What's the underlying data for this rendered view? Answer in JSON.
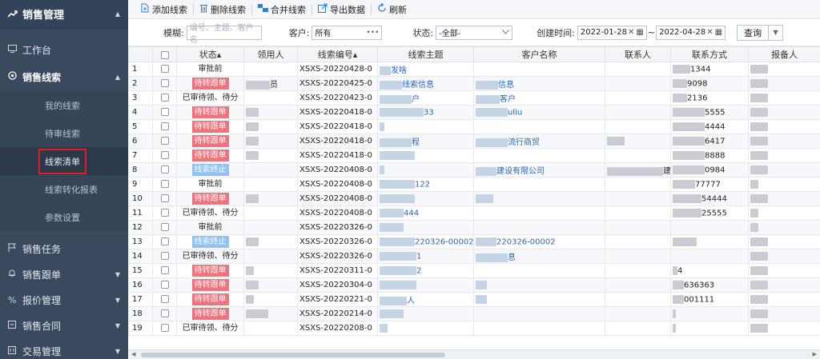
{
  "sidebar": {
    "header": {
      "icon": "trend-line-icon",
      "label": "销售管理"
    },
    "items": [
      {
        "icon": "monitor-icon",
        "label": "工作台"
      },
      {
        "icon": "settings-icon",
        "label": "销售线索",
        "expanded": true,
        "children": [
          {
            "label": "我的线索"
          },
          {
            "label": "待审线索"
          },
          {
            "label": "线索清单",
            "active": true
          },
          {
            "label": "线索转化报表"
          },
          {
            "label": "参数设置"
          }
        ]
      },
      {
        "icon": "flag-icon",
        "label": "销售任务"
      },
      {
        "icon": "bell-icon",
        "label": "销售跟单"
      },
      {
        "icon": "percent-icon",
        "label": "报价管理"
      },
      {
        "icon": "contract-icon",
        "label": "销售合同"
      },
      {
        "icon": "deal-icon",
        "label": "交易管理"
      }
    ]
  },
  "toolbar": {
    "add": "添加线索",
    "delete": "删除线索",
    "merge": "合并线索",
    "export": "导出数据",
    "refresh": "刷新"
  },
  "filters": {
    "fuzzy_label": "模糊:",
    "fuzzy_placeholder": "编号、主题、客户名",
    "customer_label": "客户:",
    "customer_value": "所有",
    "status_label": "状态:",
    "status_value": "-全部-",
    "created_label": "创建时间:",
    "date_from": "2022-01-28",
    "date_to": "2022-04-28",
    "range_sep": "~",
    "query_label": "查询"
  },
  "table": {
    "columns": [
      "",
      "",
      "状态",
      "领用人",
      "线索编号",
      "线索主题",
      "客户名称",
      "联系人",
      "联系方式",
      "报备人"
    ],
    "sort_marks": {
      "状态": "▴",
      "线索编号": "▴"
    },
    "rows": [
      {
        "n": "1",
        "status": "审批前",
        "status_style": "plain",
        "owner": "",
        "code": "XSXS-20220428-0",
        "topic": "发啥",
        "customer": "",
        "contact": "",
        "phone": "1344",
        "reporter": ""
      },
      {
        "n": "2",
        "status": "待转跟单",
        "status_style": "red",
        "owner": "员",
        "code": "XSXS-20220425-0",
        "topic": "线索信息",
        "customer": "信息",
        "contact": "",
        "phone": "9098",
        "reporter": ""
      },
      {
        "n": "3",
        "status": "已审待领、待分",
        "status_style": "plain",
        "owner": "",
        "code": "XSXS-20220423-0",
        "topic": "户",
        "customer": "客户",
        "contact": "",
        "phone": "2136",
        "reporter": ""
      },
      {
        "n": "4",
        "status": "待转跟单",
        "status_style": "red",
        "owner": "",
        "code": "XSXS-20220418-0",
        "topic": "33",
        "customer": "uliu",
        "contact": "",
        "phone": "5555",
        "reporter": ""
      },
      {
        "n": "5",
        "status": "待转跟单",
        "status_style": "red",
        "owner": "",
        "code": "XSXS-20220418-0",
        "topic": "",
        "customer": "",
        "contact": "",
        "phone": "4444",
        "reporter": ""
      },
      {
        "n": "6",
        "status": "待转跟单",
        "status_style": "red",
        "owner": "",
        "code": "XSXS-20220418-0",
        "topic": "程",
        "customer": "流行商贸",
        "contact": "",
        "phone": "6417",
        "reporter": ""
      },
      {
        "n": "7",
        "status": "待转跟单",
        "status_style": "red",
        "owner": "",
        "code": "XSXS-20220418-0",
        "topic": "",
        "customer": "",
        "contact": "",
        "phone": "8888",
        "reporter": ""
      },
      {
        "n": "8",
        "status": "线索终止",
        "status_style": "blue",
        "owner": "",
        "code": "XSXS-20220408-0",
        "topic": "",
        "customer": "建设有限公司",
        "contact": "建设有限公",
        "phone": "0984",
        "reporter": ""
      },
      {
        "n": "9",
        "status": "审批前",
        "status_style": "plain",
        "owner": "",
        "code": "XSXS-20220408-0",
        "topic": "122",
        "customer": "",
        "contact": "",
        "phone": "77777",
        "reporter": ""
      },
      {
        "n": "10",
        "status": "待转跟单",
        "status_style": "red",
        "owner": "",
        "code": "XSXS-20220408-0",
        "topic": "",
        "customer": "",
        "contact": "",
        "phone": "54444",
        "reporter": ""
      },
      {
        "n": "11",
        "status": "已审待领、待分",
        "status_style": "plain",
        "owner": "",
        "code": "XSXS-20220408-0",
        "topic": "444",
        "customer": "",
        "contact": "",
        "phone": "25555",
        "reporter": ""
      },
      {
        "n": "12",
        "status": "审批前",
        "status_style": "plain",
        "owner": "",
        "code": "XSXS-20220326-0",
        "topic": "",
        "customer": "",
        "contact": "",
        "phone": "",
        "reporter": ""
      },
      {
        "n": "13",
        "status": "线索终止",
        "status_style": "blue",
        "owner": "",
        "code": "XSXS-20220326-0",
        "topic": "220326-00002",
        "customer": "220326-00002",
        "contact": "",
        "phone": "",
        "reporter": ""
      },
      {
        "n": "14",
        "status": "已审待领、待分",
        "status_style": "plain",
        "owner": "",
        "code": "XSXS-20220326-0",
        "topic": "1",
        "customer": "息",
        "contact": "",
        "phone": "",
        "reporter": ""
      },
      {
        "n": "15",
        "status": "待转跟单",
        "status_style": "red",
        "owner": "",
        "code": "XSXS-20220311-0",
        "topic": "2",
        "customer": "",
        "contact": "",
        "phone": "4",
        "reporter": ""
      },
      {
        "n": "16",
        "status": "待转跟单",
        "status_style": "red",
        "owner": "",
        "code": "XSXS-20220304-0",
        "topic": "",
        "customer": "",
        "contact": "",
        "phone": "636363",
        "reporter": ""
      },
      {
        "n": "17",
        "status": "待转跟单",
        "status_style": "red",
        "owner": "",
        "code": "XSXS-20220221-0",
        "topic": "人",
        "customer": "",
        "contact": "",
        "phone": "001111",
        "reporter": ""
      },
      {
        "n": "18",
        "status": "待转跟单",
        "status_style": "red",
        "owner": "",
        "code": "XSXS-20220214-0",
        "topic": "",
        "customer": "",
        "contact": "",
        "phone": "",
        "reporter": ""
      },
      {
        "n": "19",
        "status": "已审待领、待分",
        "status_style": "plain",
        "owner": "",
        "code": "XSXS-20220208-0",
        "topic": "",
        "customer": "",
        "contact": "",
        "phone": "",
        "reporter": ""
      }
    ]
  },
  "colors": {
    "sidebar_bg": "#3a4a5e",
    "badge_red": "#f0727c",
    "badge_blue": "#8fc2f5",
    "link": "#2667b8",
    "active_outline": "#e02020"
  }
}
